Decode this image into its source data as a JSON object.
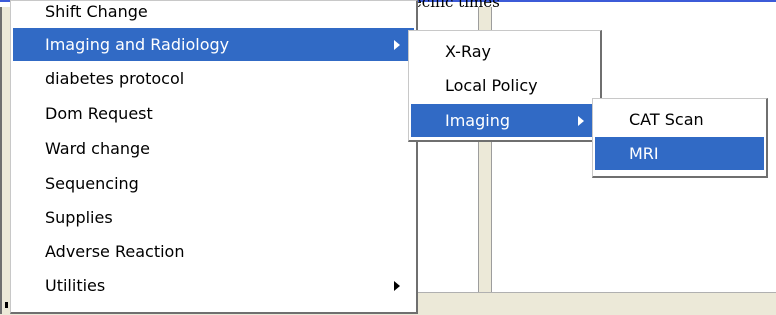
{
  "header": {
    "partial_text": "…pted at specific times"
  },
  "menu_main": {
    "items": [
      {
        "label": "Shift Change",
        "submenu": false,
        "highlighted": false
      },
      {
        "label": "Imaging and Radiology",
        "submenu": true,
        "highlighted": true
      },
      {
        "label": "diabetes protocol",
        "submenu": false,
        "highlighted": false
      },
      {
        "label": "Dom Request",
        "submenu": false,
        "highlighted": false
      },
      {
        "label": "Ward change",
        "submenu": false,
        "highlighted": false
      },
      {
        "label": "Sequencing",
        "submenu": false,
        "highlighted": false
      },
      {
        "label": "Supplies",
        "submenu": false,
        "highlighted": false
      },
      {
        "label": "Adverse Reaction",
        "submenu": false,
        "highlighted": false
      },
      {
        "label": "Utilities",
        "submenu": true,
        "highlighted": false
      }
    ]
  },
  "menu_imaging_radiology": {
    "items": [
      {
        "label": "X-Ray",
        "submenu": false,
        "highlighted": false
      },
      {
        "label": "Local Policy",
        "submenu": false,
        "highlighted": false
      },
      {
        "label": "Imaging",
        "submenu": true,
        "highlighted": true
      }
    ]
  },
  "menu_imaging": {
    "items": [
      {
        "label": "CAT Scan",
        "submenu": false,
        "highlighted": false
      },
      {
        "label": "MRI",
        "submenu": false,
        "highlighted": true
      }
    ]
  },
  "colors": {
    "highlight": "#316ac5",
    "face": "#ece9d8",
    "window_border": "#3c5bd8"
  }
}
